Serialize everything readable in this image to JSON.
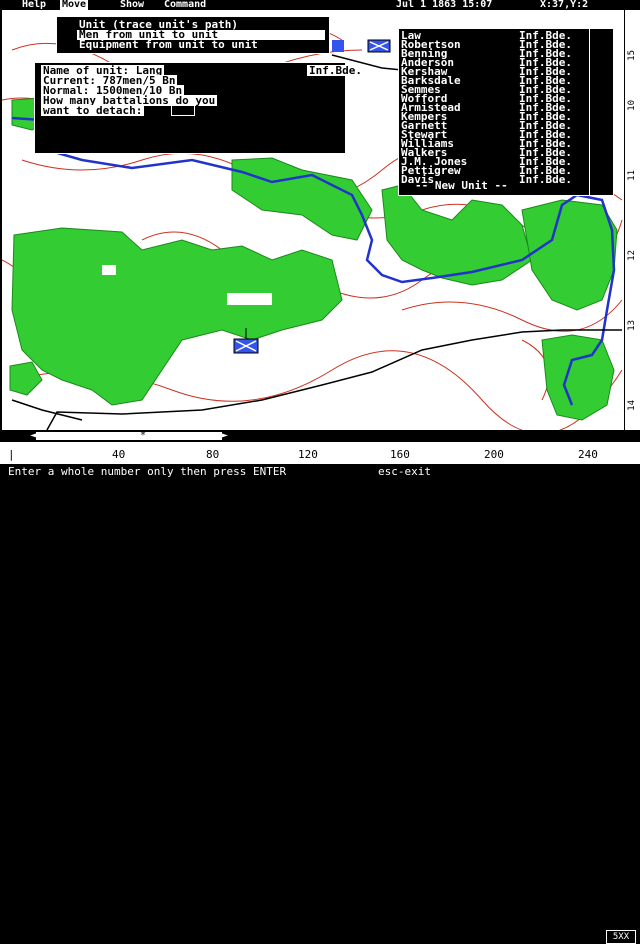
{
  "menubar": {
    "items": [
      {
        "label": "Help",
        "active": false
      },
      {
        "label": "Move",
        "active": true
      },
      {
        "label": "Show",
        "active": false
      },
      {
        "label": "Command",
        "active": false
      }
    ],
    "date": "Jul 1 1863 15:07",
    "coords": "X:37,Y:2"
  },
  "unit_menu": {
    "items": [
      {
        "label": "Unit (trace unit's path)"
      },
      {
        "label": "Men from unit to unit"
      },
      {
        "label": "Equipment from unit to unit"
      }
    ],
    "selected_index": 1
  },
  "detach_dialog": {
    "unit_name": "Name of unit: Lang",
    "unit_type": "Inf.Bde.",
    "current": "Current: 787men/5 Bn",
    "normal": "Normal:  1500men/10 Bn",
    "prompt_1": "How many battalions do you",
    "prompt_2": " want to detach:",
    "input_value": ""
  },
  "brigade_list": {
    "rows": [
      {
        "name": "Law",
        "type": "Inf.Bde."
      },
      {
        "name": "Robertson",
        "type": "Inf.Bde."
      },
      {
        "name": "Benning",
        "type": "Inf.Bde."
      },
      {
        "name": "Anderson",
        "type": "Inf.Bde."
      },
      {
        "name": "Kershaw",
        "type": "Inf.Bde."
      },
      {
        "name": "Barksdale",
        "type": "Inf.Bde."
      },
      {
        "name": "Semmes",
        "type": "Inf.Bde."
      },
      {
        "name": "Wofford",
        "type": "Inf.Bde."
      },
      {
        "name": "Armistead",
        "type": "Inf.Bde."
      },
      {
        "name": "Kempers",
        "type": "Inf.Bde."
      },
      {
        "name": "Garnett",
        "type": "Inf.Bde."
      },
      {
        "name": "Stewart",
        "type": "Inf.Bde."
      },
      {
        "name": "Williams",
        "type": "Inf.Bde."
      },
      {
        "name": "Walkers",
        "type": "Inf.Bde."
      },
      {
        "name": "J.M. Jones",
        "type": "Inf.Bde."
      },
      {
        "name": "Pettigrew",
        "type": "Inf.Bde."
      },
      {
        "name": "Davis",
        "type": "Inf.Bde."
      }
    ],
    "new_unit": "-- New Unit --"
  },
  "right_scale": [
    "10",
    "11",
    "12",
    "13",
    "14",
    "15"
  ],
  "ruler": [
    "40",
    "80",
    "120",
    "160",
    "200",
    "240"
  ],
  "hscroll": {
    "left_arrow": "◄",
    "thumb": "*",
    "right_arrow": "►"
  },
  "status": {
    "text": "Enter a whole number only then press ENTER",
    "exit": "esc-exit",
    "corner": "5XX"
  },
  "colors": {
    "forest": "#33cc33",
    "contour": "#cc3322",
    "river": "#2233cc",
    "road": "#000000",
    "unit_marker": "#3355ee"
  }
}
